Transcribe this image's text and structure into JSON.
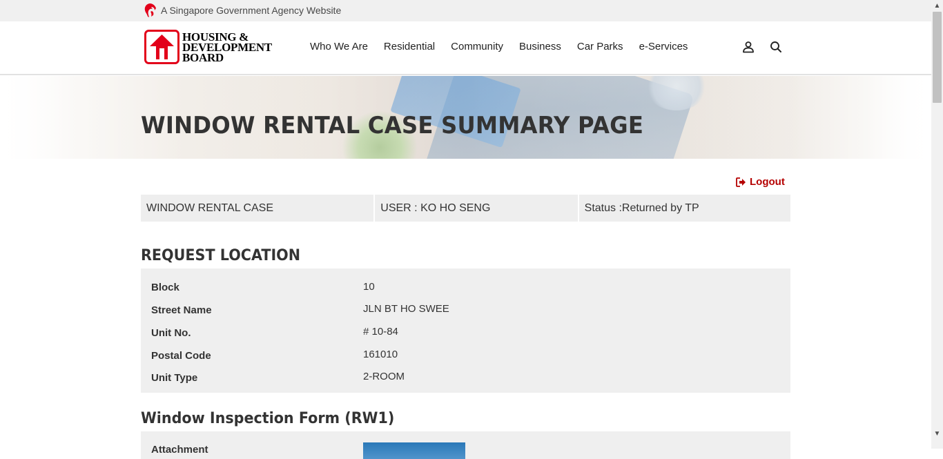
{
  "gov_banner": {
    "text": "A Singapore Government Agency Website",
    "icon": "lion-head-icon"
  },
  "header": {
    "logo_lines": [
      "HOUSING &",
      "DEVELOPMENT",
      "BOARD"
    ],
    "nav": [
      "Who We Are",
      "Residential",
      "Community",
      "Business",
      "Car Parks",
      "e-Services"
    ],
    "icons": [
      "user-icon",
      "search-icon"
    ]
  },
  "hero": {
    "title": "WINDOW RENTAL CASE SUMMARY PAGE"
  },
  "logout": {
    "label": "Logout",
    "icon": "sign-out-icon"
  },
  "case_bar": {
    "case_type": "WINDOW RENTAL CASE",
    "user": "USER : KO HO SENG",
    "status": "Status :Returned by TP"
  },
  "request_location": {
    "title": "REQUEST LOCATION",
    "rows": [
      {
        "label": "Block",
        "value": "10"
      },
      {
        "label": "Street Name",
        "value": "JLN BT HO SWEE"
      },
      {
        "label": "Unit No.",
        "value": "# 10-84"
      },
      {
        "label": "Postal Code",
        "value": "161010"
      },
      {
        "label": "Unit Type",
        "value": "2-ROOM"
      }
    ]
  },
  "inspection_form": {
    "title": "Window Inspection Form (RW1)",
    "attachment_label": "Attachment"
  },
  "colors": {
    "brand_red": "#e2001a",
    "logout_red": "#b50000",
    "panel_grey": "#efefef"
  }
}
